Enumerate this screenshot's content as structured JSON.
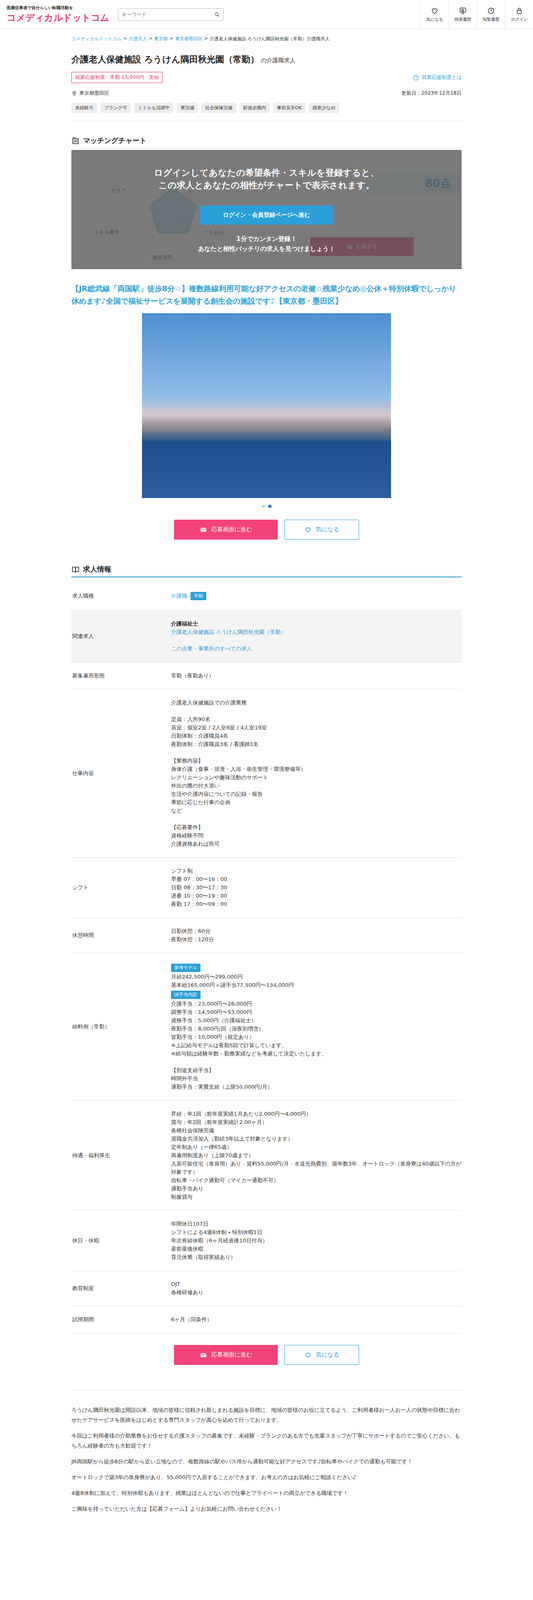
{
  "header": {
    "tagline": "医療従事者で自分らしい転職活動を",
    "logo": "コメディカルドットコム",
    "search": {
      "placeholder": "キーワード"
    },
    "nav": [
      {
        "label": "気になる"
      },
      {
        "label": "検索履歴"
      },
      {
        "label": "閲覧履歴"
      },
      {
        "label": "ログイン"
      }
    ]
  },
  "breadcrumb": {
    "separator": ">",
    "items": [
      "コメディカルドットコム",
      "介護求人",
      "東京都",
      "東京都墨田区",
      "介護老人保健施設 ろうけん隅田秋光園（常勤）介護職求人"
    ]
  },
  "title": {
    "main": "介護老人保健施設 ろうけん隅田秋光園（常勤）",
    "suffix": "の介護職求人"
  },
  "support_badge": "就業応援制度　常勤 15,000円　支給",
  "support_link": "就業応援制度とは",
  "location": "東京都墨田区",
  "updated": "更新日：2023年12月18日",
  "tags": [
    "未経験可",
    "ブランク可",
    "ミドルも活躍中",
    "寮完備",
    "社会保険完備",
    "駅徒歩圏内",
    "事前見学OK",
    "残業少なめ"
  ],
  "matching": {
    "heading": "マッチングチャート",
    "axes": [
      "エリア",
      "スキル要件",
      "施設形態",
      "こだわり"
    ],
    "score": "80点",
    "apply": "応募する",
    "overlay_lines": [
      "ログインしてあなたの希望条件・スキルを登録すると、",
      "この求人とあなたの相性がチャートで表示されます。"
    ],
    "login_button": "ログイン・会員登録ページへ進む",
    "promo": [
      "1分でカンタン登録！",
      "あなたと相性バッチリの求人を見つけましょう！"
    ]
  },
  "headline": "【JR総武線「両国駅」徒歩8分☆】複数路線利用可能な好アクセスの老健☆残業少なめ◎公休＋特別休暇でしっかり休めます♪全国で福祉サービスを展開する創生会の施設です♪【東京都・墨田区】",
  "carousel": {
    "dots": [
      {
        "selected": false
      },
      {
        "selected": true
      }
    ]
  },
  "actions": [
    {
      "apply": "応募画面に進む",
      "favorite": "気になる"
    },
    {
      "apply": "応募画面に進む",
      "favorite": "気になる"
    }
  ],
  "job_info": {
    "heading": "求人情報",
    "rows": [
      {
        "label": "求人職種",
        "shaded": false,
        "inline": true,
        "items": [
          {
            "kind": "link",
            "text": "介護職"
          },
          {
            "kind": "badge",
            "text": "常勤"
          }
        ]
      },
      {
        "label": "関連求人",
        "shaded": true,
        "inline": false,
        "items": [
          {
            "kind": "bold",
            "text": "介護福祉士"
          },
          {
            "kind": "link",
            "text": "介護老人保健施設 ろうけん隅田秋光園（常勤）"
          },
          {
            "kind": "spacer"
          },
          {
            "kind": "link",
            "text": "この企業・事業所のすべての求人"
          }
        ]
      },
      {
        "label": "募集雇用形態",
        "shaded": false,
        "inline": false,
        "items": [
          {
            "kind": "text",
            "text": "常勤（夜勤あり）"
          }
        ]
      },
      {
        "label": "仕事内容",
        "shaded": false,
        "inline": false,
        "items": [
          {
            "kind": "text",
            "text": "介護老人保健施設での介護業務"
          },
          {
            "kind": "spacer"
          },
          {
            "kind": "text",
            "text": "定員：入所90名"
          },
          {
            "kind": "text",
            "text": "居室：個室2室 / 2人室6室 / 4人室19室"
          },
          {
            "kind": "text",
            "text": "日勤体制：介護職員4名"
          },
          {
            "kind": "text",
            "text": "夜勤体制：介護職員3名 / 看護師1名"
          },
          {
            "kind": "spacer"
          },
          {
            "kind": "text",
            "text": "【業務内容】"
          },
          {
            "kind": "text",
            "text": "身体介護（食事・排泄・入浴・衛生管理・環境整備等）"
          },
          {
            "kind": "text",
            "text": "レクリエーションや趣味活動のサポート"
          },
          {
            "kind": "text",
            "text": "外出の際の付き添い"
          },
          {
            "kind": "text",
            "text": "生活や介護内容についての記録・報告"
          },
          {
            "kind": "text",
            "text": "季節に応じた行事の企画"
          },
          {
            "kind": "text",
            "text": "など"
          },
          {
            "kind": "spacer"
          },
          {
            "kind": "text",
            "text": "【応募要件】"
          },
          {
            "kind": "text",
            "text": "資格経験不問"
          },
          {
            "kind": "text",
            "text": "介護資格あれば尚可"
          }
        ]
      },
      {
        "label": "シフト",
        "shaded": false,
        "inline": false,
        "items": [
          {
            "kind": "text",
            "text": "シフト制"
          },
          {
            "kind": "text",
            "text": "早番 07：00〜16：00"
          },
          {
            "kind": "text",
            "text": "日勤 08：30〜17：30"
          },
          {
            "kind": "text",
            "text": "遅番 10：00〜19：00"
          },
          {
            "kind": "text",
            "text": "夜勤 17：00〜09：00"
          }
        ]
      },
      {
        "label": "休憩時間",
        "shaded": false,
        "inline": false,
        "items": [
          {
            "kind": "text",
            "text": "日勤休憩：60分"
          },
          {
            "kind": "text",
            "text": "夜勤休憩：120分"
          }
        ]
      },
      {
        "label": "給料例（常勤）",
        "shaded": false,
        "inline": false,
        "items": [
          {
            "kind": "badge",
            "text": "参考モデル"
          },
          {
            "kind": "text",
            "text": "月給242,500円〜299,000円"
          },
          {
            "kind": "text",
            "text": "基本給165,000円＋諸手当77,500円〜134,000円"
          },
          {
            "kind": "badge",
            "text": "諸手当内訳"
          },
          {
            "kind": "text",
            "text": "介護手当：23,000円〜26,000円"
          },
          {
            "kind": "text",
            "text": "調整手当：14,500円〜53,000円"
          },
          {
            "kind": "text",
            "text": "資格手当：5,000円（介護福祉士）"
          },
          {
            "kind": "text",
            "text": "夜勤手当：8,000円/回（深夜割増含）"
          },
          {
            "kind": "text",
            "text": "皆勤手当：10,000円（規定あり）"
          },
          {
            "kind": "text",
            "text": "※上記給与モデルは夜勤5回で計算しています。"
          },
          {
            "kind": "text",
            "text": "※給与額は経験年数・勤務実績などを考慮して決定いたします。"
          },
          {
            "kind": "spacer"
          },
          {
            "kind": "text",
            "text": "【別途支給手当】"
          },
          {
            "kind": "text",
            "text": "時間外手当"
          },
          {
            "kind": "text",
            "text": "通勤手当：実費支給（上限50,000円/月）"
          }
        ]
      },
      {
        "label": "待遇・福利厚生",
        "shaded": false,
        "inline": false,
        "items": [
          {
            "kind": "text",
            "text": "昇給：年1回（前年度実績1月あたり2,000円〜4,000円）"
          },
          {
            "kind": "text",
            "text": "賞与：年2回（前年度実績計2.00ヶ月）"
          },
          {
            "kind": "text",
            "text": "各種社会保険完備"
          },
          {
            "kind": "text",
            "text": "退職金共済加入（勤続3年以上で対象となります）"
          },
          {
            "kind": "text",
            "text": "定年制あり（一律65歳）"
          },
          {
            "kind": "text",
            "text": "再雇用制度あり（上限70歳まで）"
          },
          {
            "kind": "text",
            "text": "入居可能住宅（単身用）あり：賃料55,000円/月・水道光熱費別、築年数3年、オートロック（単身寮は40歳以下の方が対象です）"
          },
          {
            "kind": "text",
            "text": "自転車・バイク通勤可（マイカー通勤不可）"
          },
          {
            "kind": "text",
            "text": "通勤手当あり"
          },
          {
            "kind": "text",
            "text": "制服貸与"
          }
        ]
      },
      {
        "label": "休日・休暇",
        "shaded": false,
        "inline": false,
        "items": [
          {
            "kind": "text",
            "text": "年間休日107日"
          },
          {
            "kind": "text",
            "text": "シフトによる4週8休制＋特別休暇1日"
          },
          {
            "kind": "text",
            "text": "年次有給休暇（6ヶ月経過後10日付与）"
          },
          {
            "kind": "text",
            "text": "産前産後休暇"
          },
          {
            "kind": "text",
            "text": "育児休業（取得実績あり）"
          }
        ]
      },
      {
        "label": "教育制度",
        "shaded": false,
        "inline": false,
        "items": [
          {
            "kind": "text",
            "text": "OJT"
          },
          {
            "kind": "text",
            "text": "各種研修あり"
          }
        ]
      },
      {
        "label": "試用期間",
        "shaded": false,
        "inline": false,
        "items": [
          {
            "kind": "text",
            "text": "6ヶ月（同条件）"
          }
        ]
      }
    ]
  },
  "description": [
    "ろうけん隅田秋光園は開設以来、地域の皆様に信頼され親しまれる施設を目標に、地域の皆様のお役に立てるよう、ご利用者様お一人お一人の状態や目標に合わせたケアサービスを医師をはじめとする専門スタッフが真心を込めて行っております。",
    "今回はご利用者様の介助業務をお任せする介護スタッフの募集です。未経験・ブランクのある方でも先輩スタッフが丁寧にサポートするのでご安心ください。もちろん経験者の方も大歓迎です！",
    "JR両国駅から徒歩8分の駅から近い立地なので、複数路線の駅やバス停から通勤可能な好アクセスです♪自転車やバイクでの通勤も可能です！",
    "オートロックで築3年の単身寮があり、55,000円で入居することができます。お考えの方はお気軽にご相談ください♪",
    "4週8休制に加えて、特別休暇もあります。残業はほとんどないので仕事とプライベートの両立ができる職場です！",
    "ご興味を持っていただいた方は【応募フォーム】よりお気軽にお問い合わせください！"
  ]
}
